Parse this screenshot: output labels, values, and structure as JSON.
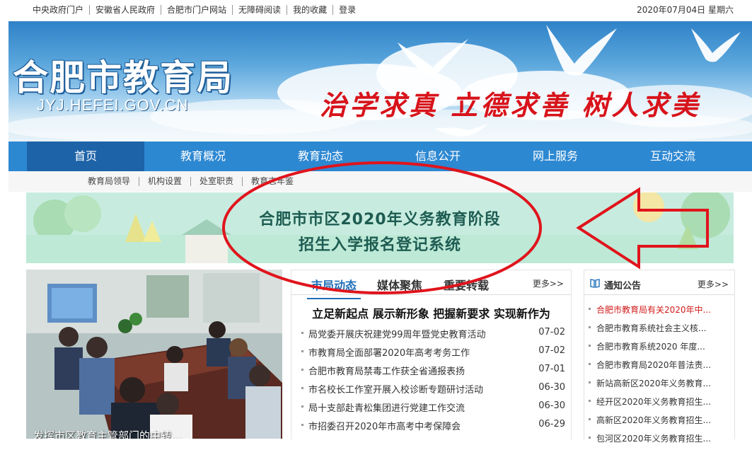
{
  "topbar": {
    "links": [
      "中央政府门户",
      "安徽省人民政府",
      "合肥市门户网站",
      "无障碍阅读",
      "我的收藏",
      "登录"
    ],
    "date": "2020年07月04日 星期六"
  },
  "banner": {
    "title": "合肥市教育局",
    "domain": "JYJ.HEFEI.GOV.CN",
    "motto": "治学求真 立德求善 树人求美"
  },
  "mainnav": {
    "items": [
      "首页",
      "教育概况",
      "教育动态",
      "信息公开",
      "网上服务",
      "互动交流"
    ]
  },
  "subnav": {
    "items": [
      "教育局领导",
      "机构设置",
      "处室职责",
      "教育志年鉴"
    ]
  },
  "promo": {
    "line1": "合肥市市区2020年义务教育阶段",
    "line2": "招生入学报名登记系统"
  },
  "photo": {
    "caption": "发挥市区教育主管部门的中转..."
  },
  "news": {
    "tabs": [
      "市局动态",
      "媒体聚焦",
      "重要转载"
    ],
    "more": "更多>>",
    "headline": "立足新起点 展示新形象 把握新要求 实现新作为",
    "items": [
      {
        "title": "局党委开展庆祝建党99周年暨党史教育活动",
        "date": "07-02"
      },
      {
        "title": "市教育局全面部署2020年高考考务工作",
        "date": "07-02"
      },
      {
        "title": "合肥市教育局禁毒工作获全省通报表扬",
        "date": "07-01"
      },
      {
        "title": "市名校长工作室开展入校诊断专题研讨活动",
        "date": "06-30"
      },
      {
        "title": "局十支部赴青松集团进行党建工作交流",
        "date": "06-30"
      },
      {
        "title": "市招委召开2020年市高考中考保障会",
        "date": "06-29"
      }
    ]
  },
  "notice": {
    "title": "通知公告",
    "more": "更多>>",
    "items": [
      "合肥市教育局有关2020年中...",
      "合肥市教育系统社会主义核...",
      "合肥市教育系统2020 年度...",
      "合肥市教育局2020年普法责...",
      "新站高新区2020年义务教育...",
      "经开区2020年义务教育招生...",
      "高新区2020年义务教育招生...",
      "包河区2020年义务教育招生..."
    ]
  },
  "colors": {
    "nav_bg": "#2d88d2",
    "nav_active": "#1d63a8",
    "motto_red": "#d8131b",
    "promo_bg": "#c7ecdf",
    "annotation_red": "#e0141c",
    "link_blue": "#1f6fb8"
  }
}
